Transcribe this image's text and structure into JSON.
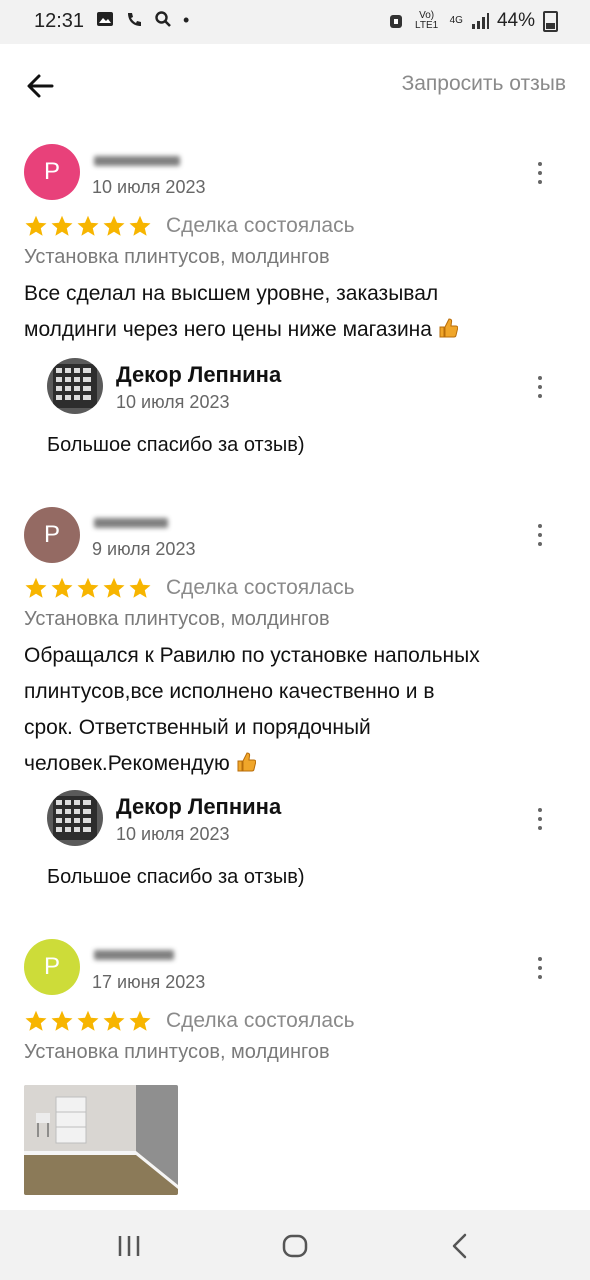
{
  "status_bar": {
    "time": "12:31",
    "network": "4G",
    "lte": "Vo) LTE1",
    "battery": "44%"
  },
  "header": {
    "action_label": "Запросить отзыв"
  },
  "reviews": [
    {
      "avatar_letter": "P",
      "avatar_color": "#e8417a",
      "date": "10 июля 2023",
      "deal": "Сделка состоялась",
      "service": "Установка плинтусов, молдингов",
      "text_lines": [
        "Все сделал на высшем уровне, заказывал",
        "молдинги через него цены ниже магазина"
      ],
      "answer": {
        "name": "Декор Лепнина",
        "date": "10 июля 2023",
        "text": "Большое спасибо за отзыв)"
      }
    },
    {
      "avatar_letter": "P",
      "avatar_color": "#946a63",
      "date": "9 июля 2023",
      "deal": "Сделка состоялась",
      "service": "Установка плинтусов, молдингов",
      "text_lines": [
        "Обращался к Равилю по установке напольных",
        "плинтусов,все исполнено качественно и в",
        "срок. Ответственный и порядочный",
        "человек.Рекомендую"
      ],
      "answer": {
        "name": "Декор Лепнина",
        "date": "10 июля 2023",
        "text": "Большое спасибо за отзыв)"
      }
    },
    {
      "avatar_letter": "P",
      "avatar_color": "#cddc39",
      "date": "17 июня 2023",
      "deal": "Сделка состоялась",
      "service": "Установка плинтусов, молдингов"
    }
  ],
  "colors": {
    "star": "#f7b500",
    "muted": "#8a8a8a"
  },
  "icons": {
    "back": "arrow-left-icon",
    "more": "kebab-icon",
    "star": "star-icon",
    "thumb": "thumbs-up-icon"
  }
}
